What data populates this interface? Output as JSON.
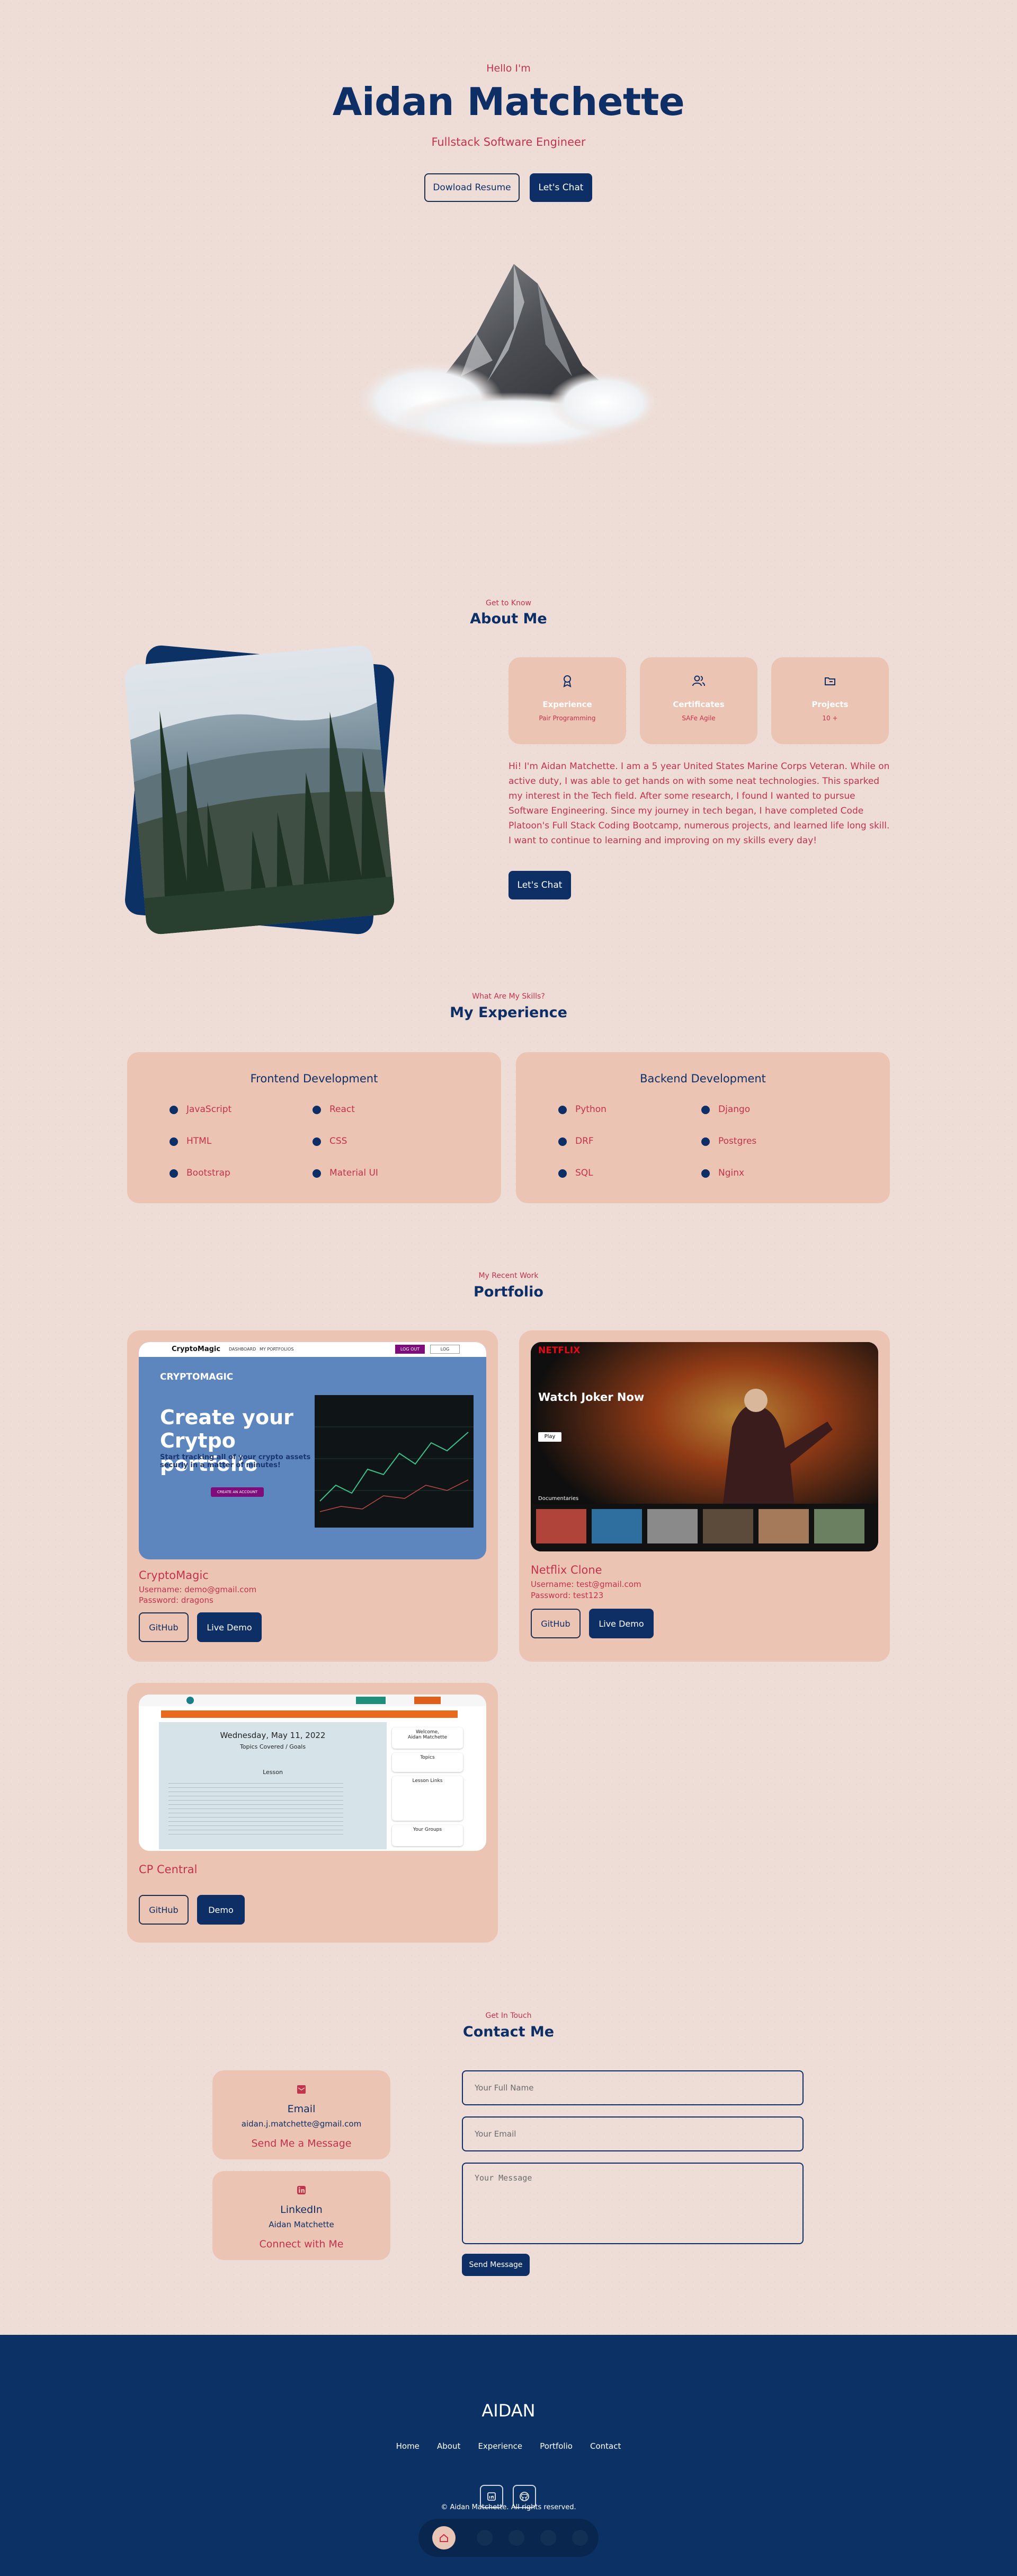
{
  "hero": {
    "greeting": "Hello I'm",
    "name": "Aidan Matchette",
    "role": "Fullstack Software Engineer",
    "resume_button": "Dowload Resume",
    "chat_button": "Let's Chat"
  },
  "about": {
    "subtitle": "Get to Know",
    "title": "About Me",
    "cards": [
      {
        "title": "Experience",
        "value": "Pair Programming",
        "icon": "award-icon"
      },
      {
        "title": "Certificates",
        "value": "SAFe Agile",
        "icon": "users-icon"
      },
      {
        "title": "Projects",
        "value": "10 +",
        "icon": "folder-icon"
      }
    ],
    "bio": "Hi! I'm Aidan Matchette. I am a 5 year United States Marine Corps Veteran. While on active duty, I was able to get hands on with some neat technologies. This sparked my interest in the Tech field. After some research, I found I wanted to pursue Software Engineering. Since my journey in tech began, I have completed Code Platoon's Full Stack Coding Bootcamp, numerous projects, and learned life long skill. I want to continue to learning and improving on my skills every day!",
    "chat_button": "Let's Chat"
  },
  "experience": {
    "subtitle": "What Are My Skills?",
    "title": "My Experience",
    "frontend": {
      "title": "Frontend Development",
      "skills": [
        "JavaScript",
        "React",
        "HTML",
        "CSS",
        "Bootstrap",
        "Material UI"
      ]
    },
    "backend": {
      "title": "Backend Development",
      "skills": [
        "Python",
        "Django",
        "DRF",
        "Postgres",
        "SQL",
        "Nginx"
      ]
    }
  },
  "portfolio": {
    "subtitle": "My Recent Work",
    "title": "Portfolio",
    "projects": [
      {
        "name": "CryptoMagic",
        "username": "Username: demo@gmail.com",
        "password": "Password: dragons",
        "github": "GitHub",
        "demo": "Live Demo",
        "shot": {
          "logo": "CryptoMagic",
          "nav1": "DASHBOARD",
          "nav2": "MY PORTFOLIOS",
          "btn1": "LOG OUT",
          "btn2": "LOG",
          "brand": "CRYPTOMAGIC",
          "headline": "Create your Crytpo portfolio",
          "tagline": "Start tracking all of your crypto assets securly in a matter of minutes!",
          "cta": "CREATE AN ACCOUNT"
        }
      },
      {
        "name": "Netflix Clone",
        "username": "Username: test@gmail.com",
        "password": "Password: test123",
        "github": "GitHub",
        "demo": "Live Demo",
        "shot": {
          "logo": "NETFLIX",
          "headline": "Watch Joker Now",
          "play": "Play",
          "row": "Documentaries"
        }
      },
      {
        "name": "CP Central",
        "github": "GitHub",
        "demo": "Demo",
        "shot": {
          "date": "Wednesday, May 11, 2022",
          "topics": "Topics Covered / Goals",
          "lesson": "Lesson",
          "welcome": "Welcome,",
          "user": "Aidan Matchette",
          "side1": "Topics",
          "side2": "Lesson Links",
          "side3": "Your Groups"
        }
      }
    ]
  },
  "contact": {
    "subtitle": "Get In Touch",
    "title": "Contact Me",
    "email": {
      "title": "Email",
      "value": "aidan.j.matchette@gmail.com",
      "link": "Send Me a Message",
      "icon": "mail-icon"
    },
    "linkedin": {
      "title": "LinkedIn",
      "value": "Aidan Matchette",
      "link": "Connect with Me",
      "icon": "linkedin-icon"
    },
    "name_placeholder": "Your Full Name",
    "email_placeholder": "Your Email",
    "message_placeholder": "Your Message",
    "send_button": "Send Message"
  },
  "footer": {
    "logo": "AIDAN",
    "nav": [
      "Home",
      "About",
      "Experience",
      "Portfolio",
      "Contact"
    ],
    "copyright": "© Aidan Matchette. All rights reserved."
  },
  "colors": {
    "background": "#eeddd7",
    "card": "#ecc4b4",
    "navy": "#0d2f66",
    "accent": "#c2334d",
    "footer": "#0c3265"
  }
}
